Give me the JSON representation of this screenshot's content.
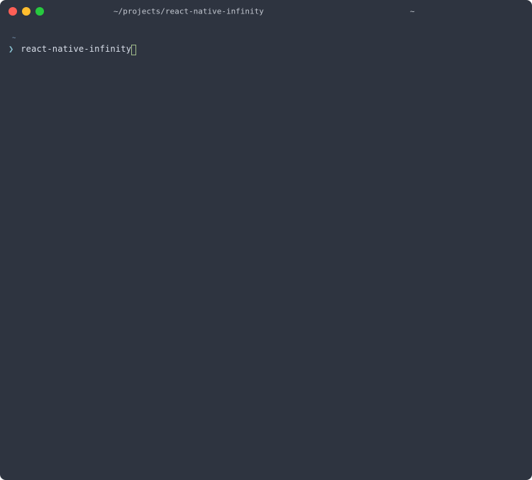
{
  "titlebar": {
    "path": "~/projects/react-native-infinity",
    "right_indicator": "~"
  },
  "prompt": {
    "context_marker": "~",
    "symbol": "❯",
    "command": "react-native-infinity"
  },
  "colors": {
    "background": "#2e3440",
    "text": "#d8dee9",
    "prompt_context": "#81a1c1",
    "prompt_symbol": "#88c0d0",
    "cursor_border": "#a3be8c",
    "tl_close": "#ff5f56",
    "tl_min": "#ffbd2e",
    "tl_max": "#27c93f"
  }
}
